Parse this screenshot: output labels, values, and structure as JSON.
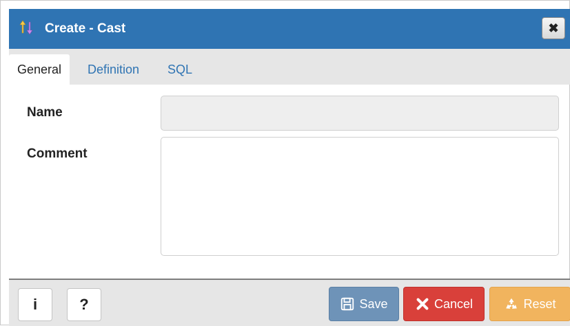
{
  "dialog": {
    "title": "Create - Cast",
    "close_glyph": "✖",
    "title_icon": "cast-icon"
  },
  "tabs": [
    {
      "label": "General",
      "active": true
    },
    {
      "label": "Definition",
      "active": false
    },
    {
      "label": "SQL",
      "active": false
    }
  ],
  "form": {
    "name_label": "Name",
    "name_value": "",
    "comment_label": "Comment",
    "comment_value": ""
  },
  "footer": {
    "info_label": "i",
    "help_label": "?",
    "save_label": "Save",
    "cancel_label": "Cancel",
    "reset_label": "Reset"
  },
  "colors": {
    "titlebar": "#2f74b3",
    "save": "#6e93b8",
    "cancel": "#d9403a",
    "reset": "#f1b45e"
  }
}
